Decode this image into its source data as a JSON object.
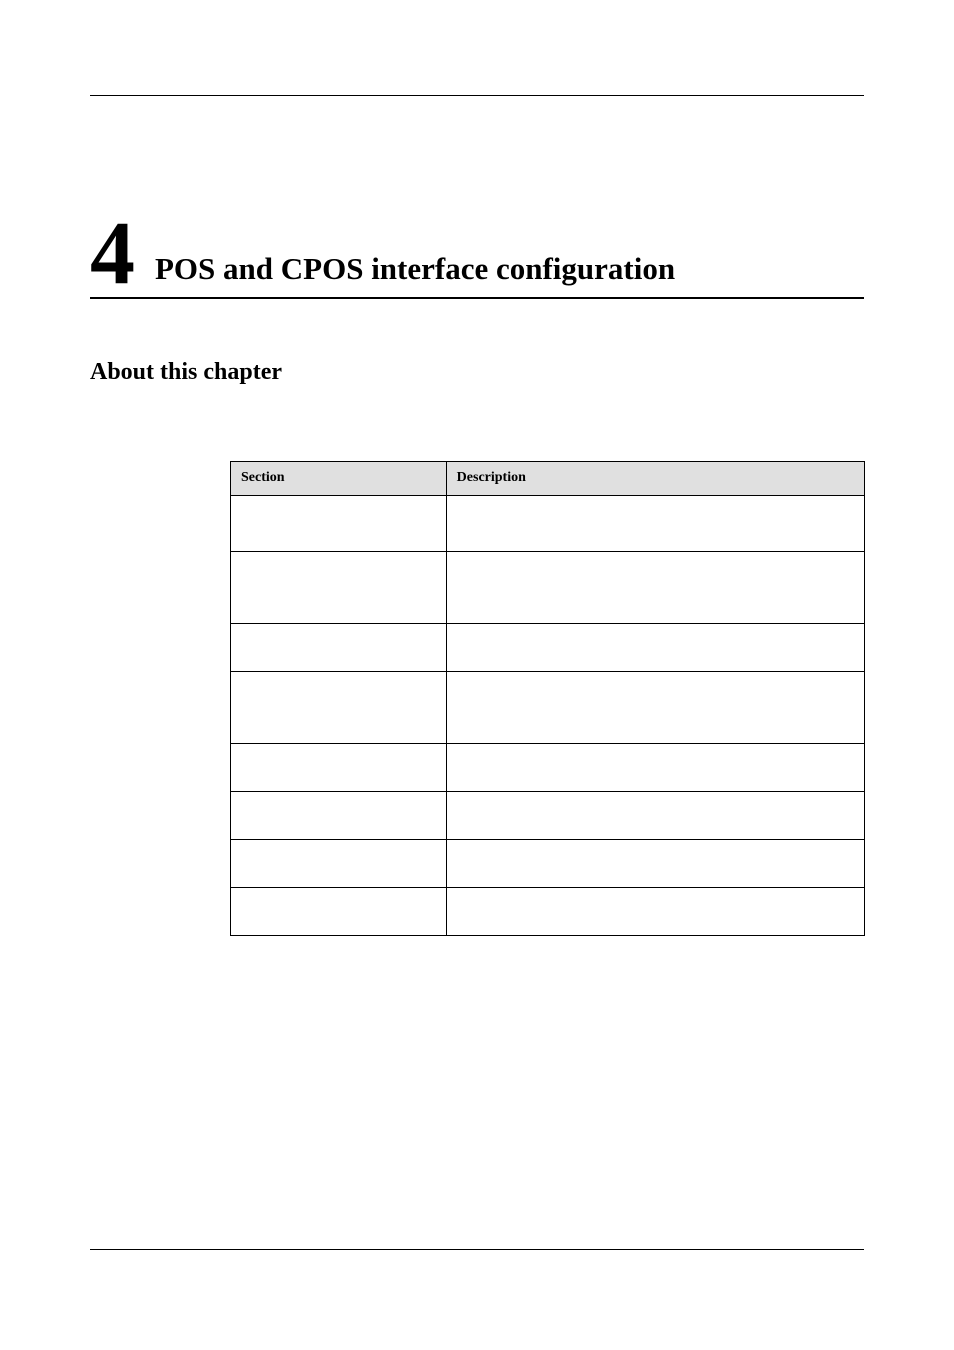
{
  "chapter": {
    "number": "4",
    "title": "POS and CPOS interface configuration"
  },
  "about_heading": "About this chapter",
  "table": {
    "headers": {
      "section": "Section",
      "description": "Description"
    },
    "rows": [
      {
        "section": "",
        "description": "",
        "height_class": "row-h2"
      },
      {
        "section": "",
        "description": "",
        "height_class": "row-h3"
      },
      {
        "section": "",
        "description": "",
        "height_class": "row-h15"
      },
      {
        "section": "",
        "description": "",
        "height_class": "row-h3"
      },
      {
        "section": "",
        "description": "",
        "height_class": "row-h15"
      },
      {
        "section": "",
        "description": "",
        "height_class": "row-h15"
      },
      {
        "section": "",
        "description": "",
        "height_class": "row-h15"
      },
      {
        "section": "",
        "description": "",
        "height_class": "row-h15"
      }
    ]
  }
}
